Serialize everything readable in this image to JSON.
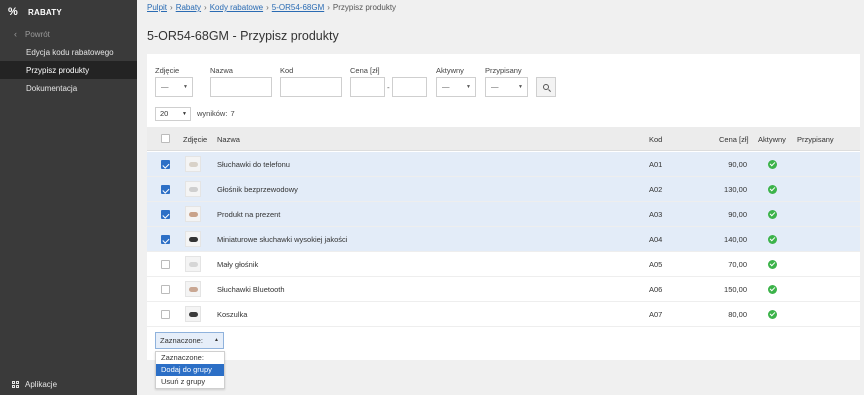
{
  "sidebar": {
    "brand": "RABATY",
    "back": "Powrót",
    "items": [
      {
        "label": "Edycja kodu rabatowego",
        "active": false
      },
      {
        "label": "Przypisz produkty",
        "active": true
      },
      {
        "label": "Dokumentacja",
        "active": false
      }
    ],
    "apps": "Aplikacje"
  },
  "breadcrumb": {
    "links": [
      "Pulpit",
      "Rabaty",
      "Kody rabatowe",
      "5-OR54-68GM"
    ],
    "current": "Przypisz produkty"
  },
  "page_title": "5-OR54-68GM - Przypisz produkty",
  "filters": {
    "photo": {
      "label": "Zdjęcie",
      "value": "—"
    },
    "name": {
      "label": "Nazwa",
      "value": ""
    },
    "code": {
      "label": "Kod",
      "value": ""
    },
    "price": {
      "label": "Cena [zł]",
      "from": "",
      "to": "",
      "sep": "-"
    },
    "active": {
      "label": "Aktywny",
      "value": "—"
    },
    "assigned": {
      "label": "Przypisany",
      "value": "—"
    }
  },
  "per_page": "20",
  "results_label": "wyników:",
  "results_count": "7",
  "table": {
    "headers": {
      "photo": "Zdjęcie",
      "name": "Nazwa",
      "code": "Kod",
      "price": "Cena [zł]",
      "active": "Aktywny",
      "assigned": "Przypisany"
    },
    "rows": [
      {
        "name": "Słuchawki do telefonu",
        "code": "A01",
        "price": "90,00",
        "checked": true,
        "thumb_color": "#d9d2c8"
      },
      {
        "name": "Głośnik bezprzewodowy",
        "code": "A02",
        "price": "130,00",
        "checked": true,
        "thumb_color": "#cfcfcf"
      },
      {
        "name": "Produkt na prezent",
        "code": "A03",
        "price": "90,00",
        "checked": true,
        "thumb_color": "#c9a38a"
      },
      {
        "name": "Miniaturowe słuchawki wysokiej jakości",
        "code": "A04",
        "price": "140,00",
        "checked": true,
        "thumb_color": "#333333"
      },
      {
        "name": "Mały głośnik",
        "code": "A05",
        "price": "70,00",
        "checked": false,
        "thumb_color": "#d6d6d6"
      },
      {
        "name": "Słuchawki Bluetooth",
        "code": "A06",
        "price": "150,00",
        "checked": false,
        "thumb_color": "#c9a793"
      },
      {
        "name": "Koszulka",
        "code": "A07",
        "price": "80,00",
        "checked": false,
        "thumb_color": "#3b3b3b"
      }
    ]
  },
  "bulk": {
    "selected": "Zaznaczone:",
    "options": [
      "Zaznaczone:",
      "Dodaj do grupy",
      "Usuń z grupy"
    ],
    "highlighted_index": 1
  },
  "colors": {
    "accent": "#2c6fc6",
    "active_ok": "#3cb34a",
    "sidebar_bg": "#3a3a3a",
    "row_selected": "#e3ecf8"
  }
}
